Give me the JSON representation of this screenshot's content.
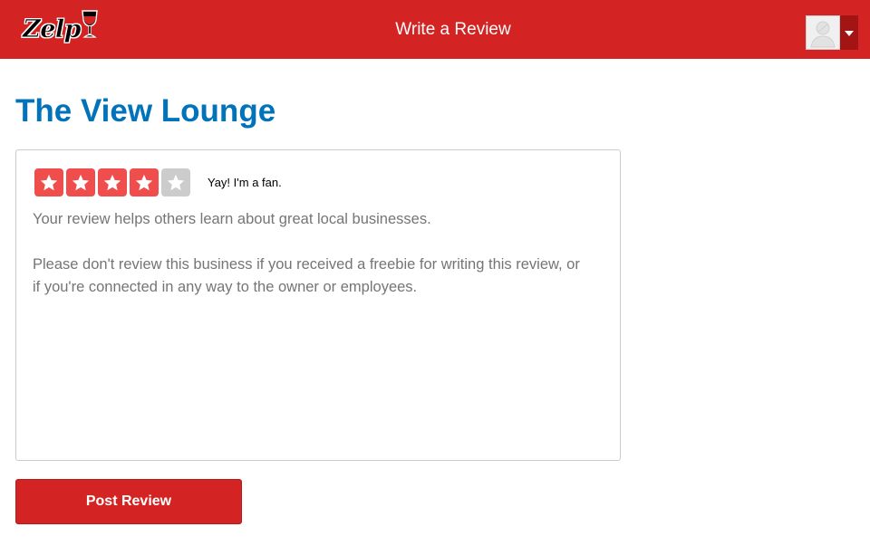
{
  "header": {
    "logo_text": "Zelp",
    "title": "Write a Review",
    "avatar_icon": "user-avatar-icon",
    "menu_icon": "caret-down-icon"
  },
  "business": {
    "name": "The View Lounge"
  },
  "rating": {
    "value": 4,
    "max": 5,
    "label": "Yay! I'm a fan."
  },
  "review": {
    "placeholder_line1": "Your review helps others learn about great local businesses.",
    "placeholder_line2": "Please don't review this business if you received a freebie for writing this review, or if you're connected in any way to the owner or employees."
  },
  "actions": {
    "post_label": "Post Review"
  },
  "colors": {
    "brand_red": "#d32323",
    "star_on": "#f04d4d",
    "star_off": "#cccccc",
    "title_blue": "#0073bb"
  }
}
